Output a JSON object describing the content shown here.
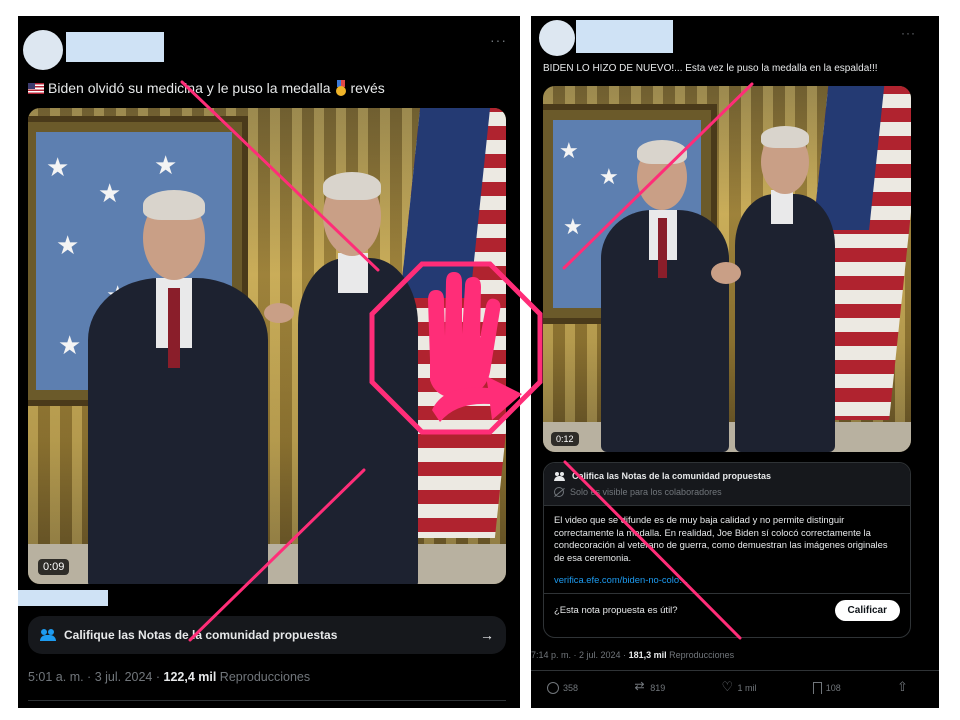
{
  "left_post": {
    "text_before": "Biden olvidó su medicina y le puso la medalla",
    "text_after": "revés",
    "flag_emoji": "us-flag-emoji",
    "medal_emoji": "medal-emoji",
    "more_label": "···",
    "video_duration": "0:09",
    "notes_button_label": "Califique las Notas de la comunidad propuestas",
    "notes_arrow": "→",
    "timestamp": "5:01 a. m. · 3 jul. 2024 · ",
    "views_count": "122,4 mil",
    "views_label": " Reproducciones"
  },
  "right_post": {
    "text": "BIDEN LO HIZO DE NUEVO!... Esta vez le puso la medalla en la espalda!!!",
    "more_label": "···",
    "video_duration": "0:12",
    "note_card": {
      "title": "Califica las Notas de la comunidad propuestas",
      "visibility": "Solo es visible para los colaboradores",
      "body": "El video que se difunde es de muy baja calidad y no permite distinguir correctamente la medalla. En realidad, Joe Biden sí colocó correctamente la condecoración al veterano de guerra, como demuestran las imágenes originales de esa ceremonia.",
      "link": "verifica.efe.com/biden-no-colo…",
      "question": "¿Esta nota propuesta es útil?",
      "rate_button": "Calificar"
    },
    "timestamp": "7:14 p. m. · 2 jul. 2024 · ",
    "views_count": "181,3 mil",
    "views_label": " Reproducciones",
    "actions": {
      "replies": "358",
      "reposts": "819",
      "likes": "1 mil",
      "bookmarks": "108"
    }
  },
  "overlay": {
    "cross_color": "#ff2d78",
    "stop_sign_color": "#ff2d78",
    "icon": "stop-hand-arrow-icon"
  }
}
